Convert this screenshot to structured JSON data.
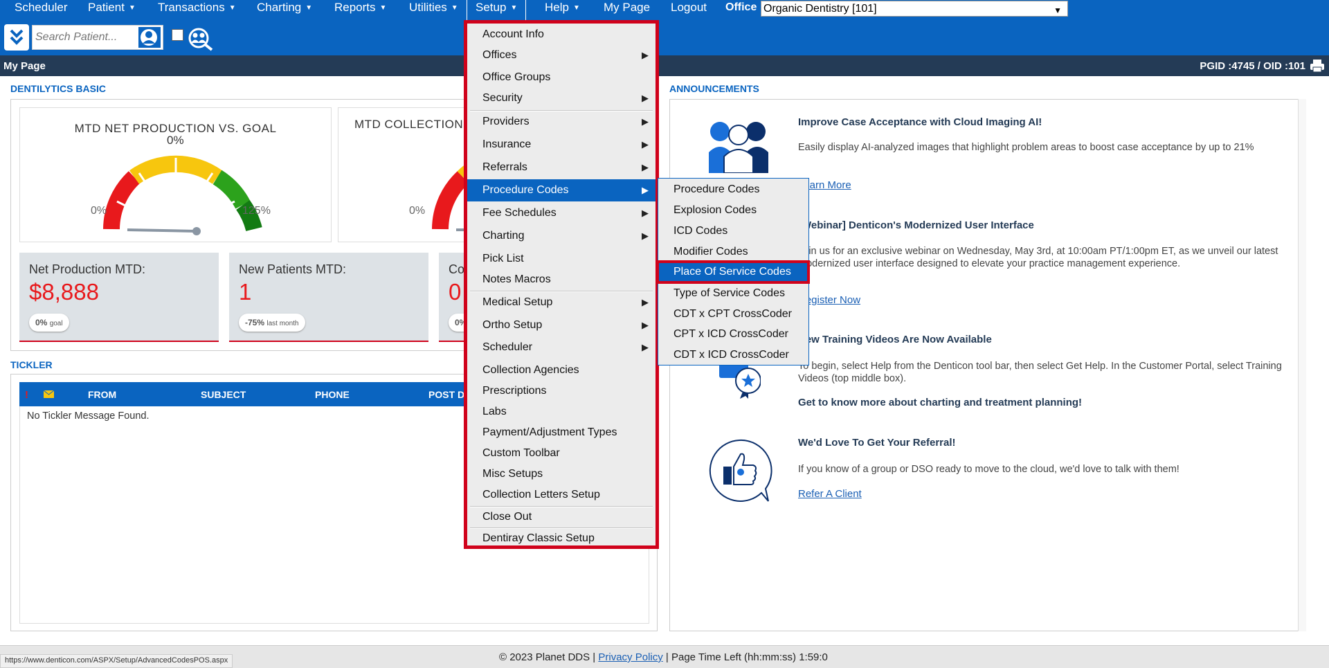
{
  "nav": {
    "scheduler": "Scheduler",
    "patient": "Patient",
    "transactions": "Transactions",
    "charting": "Charting",
    "reports": "Reports",
    "utilities": "Utilities",
    "setup": "Setup",
    "help": "Help",
    "my_page": "My Page",
    "logout": "Logout",
    "office_label": "Office",
    "office_value": "Organic Dentistry [101]"
  },
  "search": {
    "placeholder": "Search Patient..."
  },
  "titlebar": {
    "title": "My Page",
    "ids": "PGID :4745  /  OID :101"
  },
  "dentilytics": {
    "heading": "DENTILYTICS BASIC",
    "gauge1": {
      "title": "MTD NET PRODUCTION VS. GOAL",
      "value": "0%",
      "min": "0%",
      "max": "125%",
      "level": 0
    },
    "gauge2": {
      "title": "MTD COLLECTION",
      "min": "0%"
    },
    "stat1": {
      "title": "Net Production MTD:",
      "value": "$8,888",
      "pill_bold": "0%",
      "pill_text": "goal"
    },
    "stat2": {
      "title": "New Patients MTD:",
      "value": "1",
      "pill_bold": "-75%",
      "pill_text": "last month"
    },
    "stat3": {
      "title": "Co",
      "value": "0",
      "pill_bold": "0%"
    }
  },
  "tickler": {
    "heading": "TICKLER",
    "col_from": "FROM",
    "col_subject": "SUBJECT",
    "col_phone": "PHONE",
    "col_post": "POST D",
    "empty": "No Tickler Message Found."
  },
  "setup_menu": [
    "Account Info",
    "Offices",
    "Office Groups",
    "Security",
    "Providers",
    "Insurance",
    "Referrals",
    "Procedure Codes",
    "Fee Schedules",
    "Charting",
    "Pick List",
    "Notes Macros",
    "Medical Setup",
    "Ortho Setup",
    "Scheduler",
    "Collection Agencies",
    "Prescriptions",
    "Labs",
    "Payment/Adjustment Types",
    "Custom Toolbar",
    "Misc Setups",
    "Collection Letters Setup",
    "Close Out",
    "Dentiray Classic Setup"
  ],
  "procedure_submenu": [
    "Procedure Codes",
    "Explosion Codes",
    "ICD Codes",
    "Modifier Codes",
    "Place Of Service Codes",
    "Type of Service Codes",
    "CDT x CPT CrossCoder",
    "CPT x ICD CrossCoder",
    "CDT x ICD CrossCoder"
  ],
  "announcements": {
    "heading": "ANNOUNCEMENTS",
    "a1_title": "Improve Case Acceptance with Cloud Imaging AI!",
    "a1_text": "Easily display AI-analyzed images that highlight problem areas to boost case acceptance by up to 21%",
    "a1_link": "Learn More",
    "a2_title": "[Webinar] Denticon's Modernized User Interface",
    "a2_text": "Join us for an exclusive webinar on Wednesday, May 3rd, at 10:00am PT/1:00pm ET, as we unveil our latest modernized user interface designed to elevate your practice management experience.",
    "a2_link": "Register Now",
    "a3_title": "New Training Videos Are Now Available",
    "a3_text": "To begin, select Help from the Denticon tool bar, then select Get Help. In the Customer Portal, select Training Videos (top middle box).",
    "a3_sub": "Get to know more about charting and treatment planning!",
    "a4_title": "We'd Love To Get Your Referral!",
    "a4_text": "If you know of a group or DSO ready to move to the cloud, we'd love to talk with them!",
    "a4_link": "Refer A Client"
  },
  "footer": {
    "copyright": "© 2023 Planet DDS |",
    "privacy": "Privacy Policy",
    "time": "| Page Time Left (hh:mm:ss) 1:59:0",
    "status_url": "https://www.denticon.com/ASPX/Setup/AdvancedCodesPOS.aspx"
  },
  "colors": {
    "brand_blue": "#0a64c0",
    "highlight_red": "#d0021b",
    "dark_bar": "#243b56"
  }
}
